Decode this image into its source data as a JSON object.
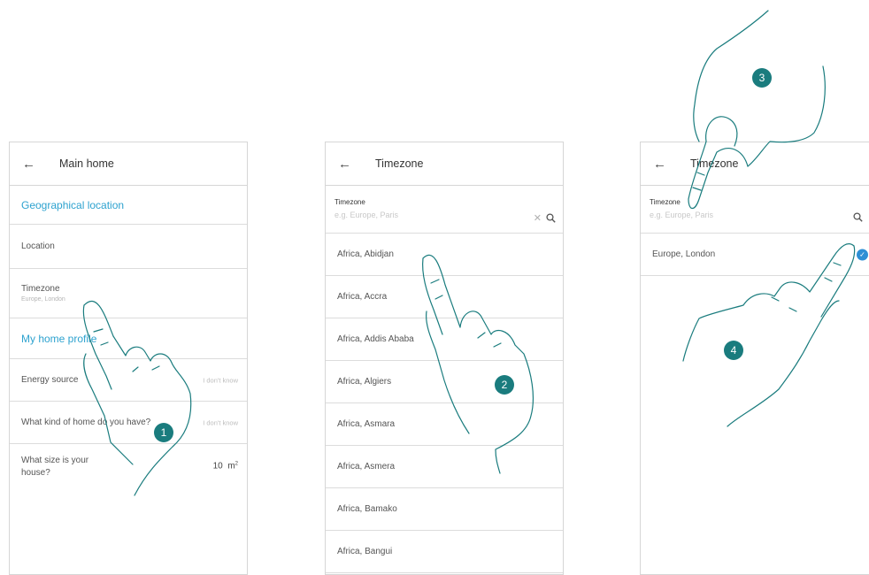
{
  "screens": {
    "main_home": {
      "title": "Main home",
      "section_geo": "Geographical location",
      "location_label": "Location",
      "timezone_label": "Timezone",
      "timezone_value": "Europe, London",
      "section_profile": "My home profile",
      "energy_label": "Energy source",
      "energy_value": "I don't know",
      "kind_label": "What kind of home do you have?",
      "kind_value": "I don't know",
      "size_label_1": "What size is your",
      "size_label_2": "house?",
      "size_value": "10",
      "size_unit": "m",
      "size_unit_exp": "2"
    },
    "timezone_list": {
      "title": "Timezone",
      "field_label": "Timezone",
      "placeholder": "e.g. Europe, Paris",
      "items": [
        "Africa, Abidjan",
        "Africa, Accra",
        "Africa, Addis Ababa",
        "Africa, Algiers",
        "Africa, Asmara",
        "Africa, Asmera",
        "Africa, Bamako",
        "Africa, Bangui"
      ]
    },
    "timezone_selected": {
      "title": "Timezone",
      "field_label": "Timezone",
      "placeholder": "e.g. Europe, Paris",
      "selected_item": "Europe, London"
    }
  },
  "steps": [
    "1",
    "2",
    "3",
    "4"
  ],
  "icons": {
    "back": "back-arrow-icon",
    "search": "search-icon",
    "clear": "clear-icon",
    "check": "check-icon"
  },
  "colors": {
    "accent": "#2da2cf",
    "step_badge": "#1a7c7e",
    "check": "#2d8fd5",
    "hand_outline": "#1a7c7e"
  }
}
